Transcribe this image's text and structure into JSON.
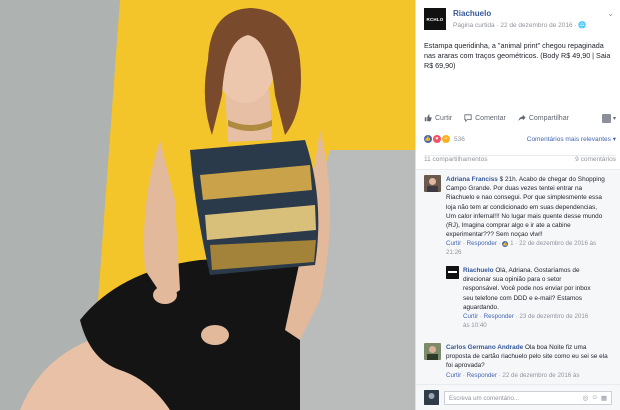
{
  "post": {
    "page_logo_text": "RCHLO",
    "page_name": "Riachuelo",
    "meta": "Página curtida · 22 de dezembro de 2016 · ",
    "text": "Estampa queridinha, a \"animal print\" chegou repaginada nas araras com traços geométricos. (Body R$ 49,90 | Saia R$ 69,90)"
  },
  "actions": {
    "like_label": "Curtir",
    "comment_label": "Comentar",
    "share_label": "Compartilhar"
  },
  "reactions": {
    "count": "536",
    "relevance_label": "Comentários mais relevantes ▾"
  },
  "stats": {
    "shares": "11 compartilhamentos",
    "comments": "9 comentários"
  },
  "comments": [
    {
      "author": "Adriana Franciss",
      "text": " $ 21h. Acabo de chegar do Shopping Campo Grande. Por duas vezes tentei entrar na Riachuelo e nao consegui. Por que simplesmente essa loja não tem ar condicionado em suas dependencias, Um calor infernal!!! No lugar mais quente desse mundo (RJ), Imagina comprar algo e ir ate a cabine experimentar??? Sem noçao vlw!!",
      "like": "Curtir",
      "reply": "Responder",
      "likes_count": "1",
      "time": "22 de dezembro de 2016 às 21:26"
    },
    {
      "author": "Riachuelo",
      "text": " Olá, Adriana. Gostaríamos de direcionar sua opinião para o setor responsável. Você pode nos enviar por inbox seu telefone com DDD e e-mail? Estamos aguardando.",
      "like": "Curtir",
      "reply": "Responder",
      "time": "23 de dezembro de 2016 às 10:40"
    },
    {
      "author": "Carlos Germano Andrade",
      "text": " Ola boa Noite fiz uma proposta de cartão riachuelo pelo site como eu sei se ela foi aprovada?",
      "like": "Curtir",
      "reply": "Responder",
      "time": "22 de dezembro de 2016 às"
    }
  ],
  "composer": {
    "placeholder": "Escreva um comentário..."
  },
  "colors": {
    "link_blue": "#365899",
    "accent_blue": "#4267b2",
    "photo_yellow": "#f3c52a",
    "photo_gray": "#b8bbb9"
  },
  "icons": [
    "page-logo",
    "chevron-down-icon",
    "like-thumb-icon",
    "comment-icon",
    "share-arrow-icon",
    "like-reaction-icon",
    "love-reaction-icon",
    "wow-reaction-icon",
    "camera-icon",
    "emoji-icon",
    "sticker-icon"
  ]
}
